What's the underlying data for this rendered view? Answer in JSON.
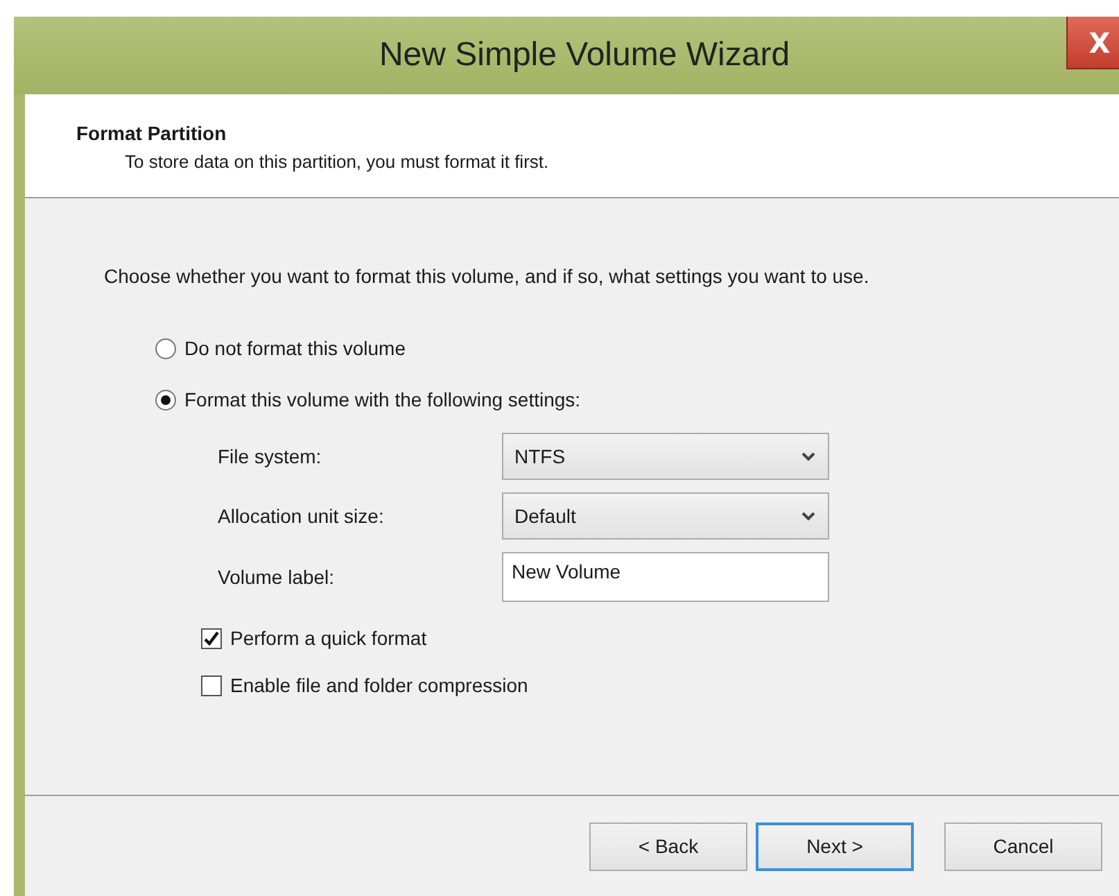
{
  "window": {
    "title": "New Simple Volume Wizard",
    "close": "X"
  },
  "header": {
    "title": "Format Partition",
    "subtitle": "To store data on this partition, you must format it first."
  },
  "intro": "Choose whether you want to format this volume, and if so, what settings you want to use.",
  "options": [
    {
      "label": "Do not format this volume",
      "selected": false
    },
    {
      "label": "Format this volume with the following settings:",
      "selected": true
    }
  ],
  "settings": [
    {
      "kind": "dropdown",
      "label": "File system:",
      "value": "NTFS"
    },
    {
      "kind": "dropdown",
      "label": "Allocation unit size:",
      "value": "Default"
    },
    {
      "kind": "text",
      "label": "Volume label:",
      "value": "New Volume"
    }
  ],
  "checkboxes": [
    {
      "label": "Perform a quick format",
      "checked": true
    },
    {
      "label": "Enable file and folder compression",
      "checked": false
    }
  ],
  "buttons": [
    {
      "label": "< Back",
      "default": false
    },
    {
      "label": "Next >",
      "default": true
    },
    {
      "label": "Cancel",
      "default": false
    }
  ]
}
